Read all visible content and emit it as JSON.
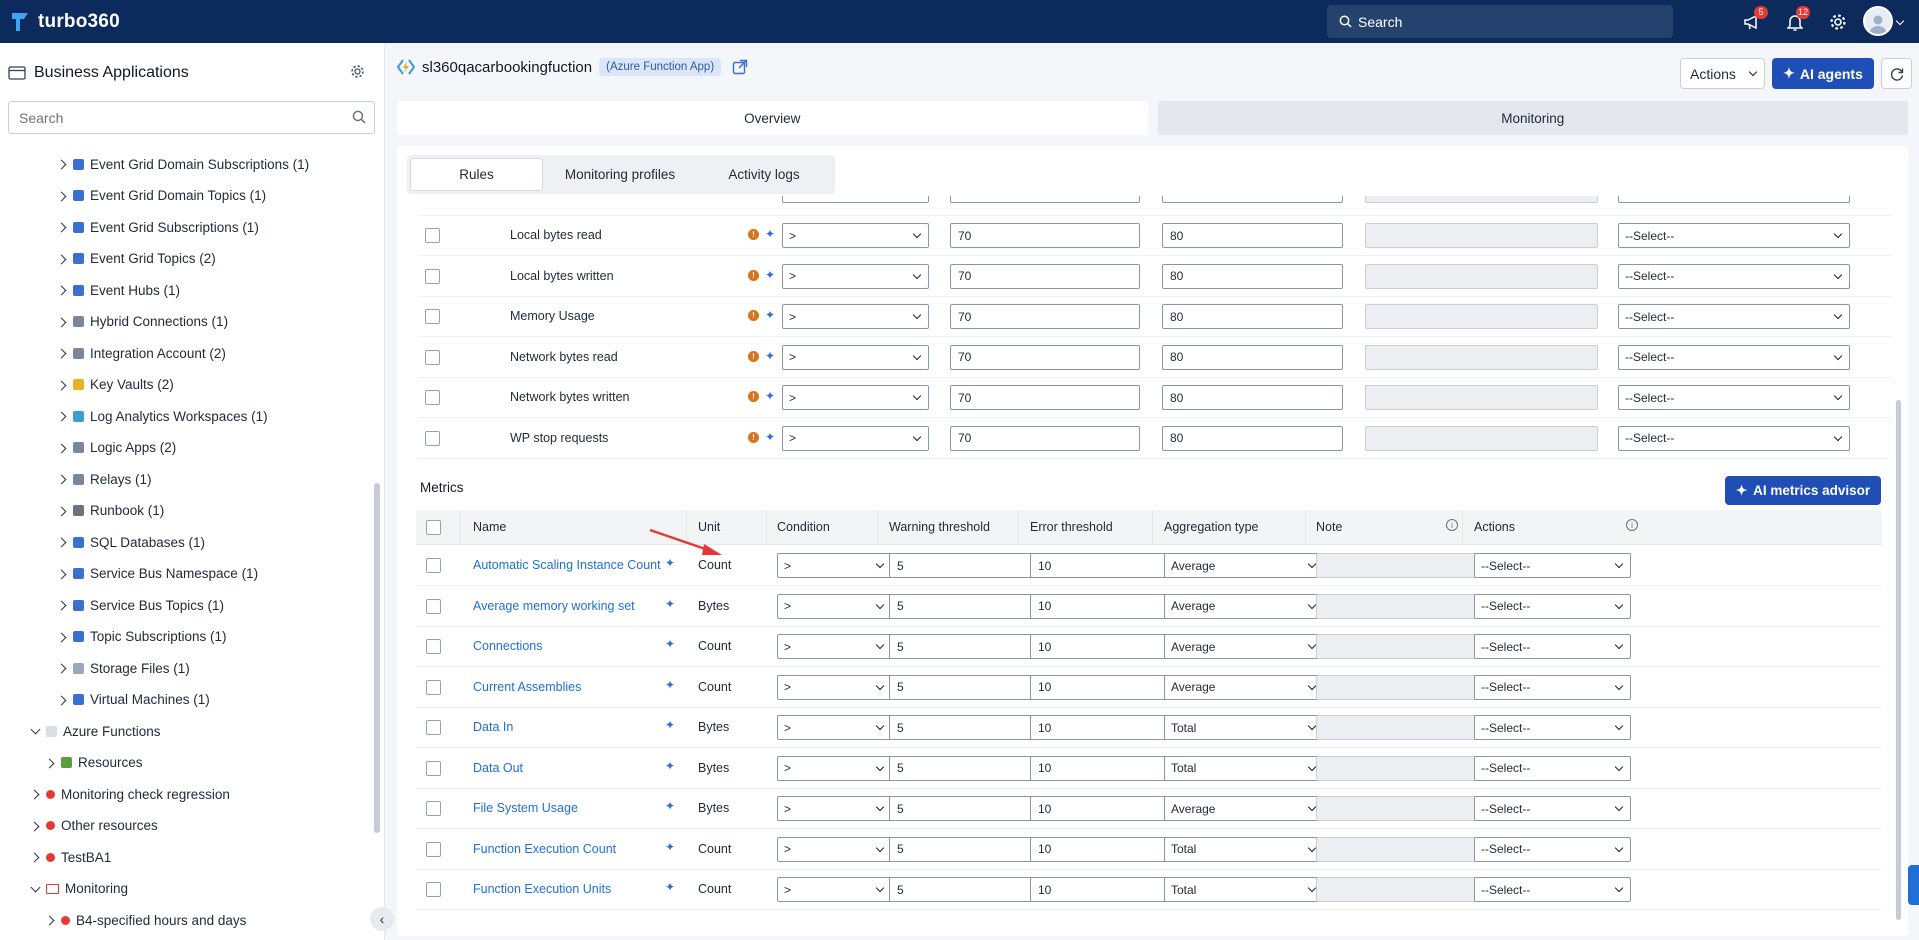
{
  "app": {
    "name": "turbo360",
    "search_placeholder": "Search",
    "notif_badge_1": "5",
    "notif_badge_2": "12"
  },
  "sidebar": {
    "title": "Business Applications",
    "search_placeholder": "Search",
    "items": [
      {
        "label": "Event Grid Domain Subscriptions (1)",
        "level": 3,
        "expand": "r",
        "color": "#3b6fd0"
      },
      {
        "label": "Event Grid Domain Topics (1)",
        "level": 3,
        "expand": "r",
        "color": "#3b6fd0"
      },
      {
        "label": "Event Grid Subscriptions (1)",
        "level": 3,
        "expand": "r",
        "color": "#3b6fd0"
      },
      {
        "label": "Event Grid Topics (2)",
        "level": 3,
        "expand": "r",
        "color": "#3b6fd0"
      },
      {
        "label": "Event Hubs (1)",
        "level": 3,
        "expand": "r",
        "color": "#3b6fd0"
      },
      {
        "label": "Hybrid Connections (1)",
        "level": 3,
        "expand": "r",
        "color": "#7a8699"
      },
      {
        "label": "Integration Account (2)",
        "level": 3,
        "expand": "r",
        "color": "#7a8699"
      },
      {
        "label": "Key Vaults (2)",
        "level": 3,
        "expand": "r",
        "color": "#e6b422"
      },
      {
        "label": "Log Analytics Workspaces (1)",
        "level": 3,
        "expand": "r",
        "color": "#3b9fd0"
      },
      {
        "label": "Logic Apps (2)",
        "level": 3,
        "expand": "r",
        "color": "#7a8699"
      },
      {
        "label": "Relays (1)",
        "level": 3,
        "expand": "r",
        "color": "#7a8699"
      },
      {
        "label": "Runbook (1)",
        "level": 3,
        "expand": "r",
        "color": "#6b7280"
      },
      {
        "label": "SQL Databases (1)",
        "level": 3,
        "expand": "r",
        "color": "#3b6fd0"
      },
      {
        "label": "Service Bus Namespace (1)",
        "level": 3,
        "expand": "r",
        "color": "#3b6fd0"
      },
      {
        "label": "Service Bus Topics (1)",
        "level": 3,
        "expand": "r",
        "color": "#3b6fd0"
      },
      {
        "label": "Topic Subscriptions (1)",
        "level": 3,
        "expand": "r",
        "color": "#3b6fd0"
      },
      {
        "label": "Storage Files (1)",
        "level": 3,
        "expand": "r",
        "color": "#9aa7bd"
      },
      {
        "label": "Virtual Machines (1)",
        "level": 3,
        "expand": "r",
        "color": "#3b6fd0"
      },
      {
        "label": "Azure Functions",
        "level": 1,
        "expand": "d",
        "color": "#d9dde4"
      },
      {
        "label": "Resources",
        "level": 2,
        "expand": "r",
        "color": "#5aa03a"
      },
      {
        "label": "Monitoring check regression",
        "level": 0,
        "expand": "r",
        "color": "red"
      },
      {
        "label": "Other resources",
        "level": 0,
        "expand": "r",
        "color": "red"
      },
      {
        "label": "TestBA1",
        "level": 0,
        "expand": "r",
        "color": "red"
      },
      {
        "label": "Monitoring",
        "level": 0,
        "expand": "d",
        "color": "folder"
      },
      {
        "label": "B4-specified hours and days",
        "level": 2,
        "expand": "r",
        "color": "red"
      }
    ]
  },
  "header": {
    "resource_name": "sl360qacarbookingfuction",
    "resource_type": "(Azure Function App)",
    "actions_label": "Actions",
    "ai_agents_label": "AI agents"
  },
  "top_tabs": [
    "Overview",
    "Monitoring"
  ],
  "sub_tabs": [
    "Rules",
    "Monitoring profiles",
    "Activity logs"
  ],
  "rules": [
    {
      "name": "Local bytes read",
      "condition": ">",
      "warning": "70",
      "error": "80",
      "action": "--Select--"
    },
    {
      "name": "Local bytes written",
      "condition": ">",
      "warning": "70",
      "error": "80",
      "action": "--Select--"
    },
    {
      "name": "Memory Usage",
      "condition": ">",
      "warning": "70",
      "error": "80",
      "action": "--Select--"
    },
    {
      "name": "Network bytes read",
      "condition": ">",
      "warning": "70",
      "error": "80",
      "action": "--Select--"
    },
    {
      "name": "Network bytes written",
      "condition": ">",
      "warning": "70",
      "error": "80",
      "action": "--Select--"
    },
    {
      "name": "WP stop requests",
      "condition": ">",
      "warning": "70",
      "error": "80",
      "action": "--Select--"
    }
  ],
  "metrics": {
    "section_label": "Metrics",
    "advisor_label": "AI metrics advisor",
    "columns": [
      "Name",
      "Unit",
      "Condition",
      "Warning threshold",
      "Error threshold",
      "Aggregation type",
      "Note",
      "Actions"
    ],
    "rows": [
      {
        "name": "Automatic Scaling Instance Count",
        "unit": "Count",
        "condition": ">",
        "warning": "5",
        "error": "10",
        "aggregation": "Average",
        "action": "--Select--"
      },
      {
        "name": "Average memory working set",
        "unit": "Bytes",
        "condition": ">",
        "warning": "5",
        "error": "10",
        "aggregation": "Average",
        "action": "--Select--"
      },
      {
        "name": "Connections",
        "unit": "Count",
        "condition": ">",
        "warning": "5",
        "error": "10",
        "aggregation": "Average",
        "action": "--Select--"
      },
      {
        "name": "Current Assemblies",
        "unit": "Count",
        "condition": ">",
        "warning": "5",
        "error": "10",
        "aggregation": "Average",
        "action": "--Select--"
      },
      {
        "name": "Data In",
        "unit": "Bytes",
        "condition": ">",
        "warning": "5",
        "error": "10",
        "aggregation": "Total",
        "action": "--Select--"
      },
      {
        "name": "Data Out",
        "unit": "Bytes",
        "condition": ">",
        "warning": "5",
        "error": "10",
        "aggregation": "Total",
        "action": "--Select--"
      },
      {
        "name": "File System Usage",
        "unit": "Bytes",
        "condition": ">",
        "warning": "5",
        "error": "10",
        "aggregation": "Average",
        "action": "--Select--"
      },
      {
        "name": "Function Execution Count",
        "unit": "Count",
        "condition": ">",
        "warning": "5",
        "error": "10",
        "aggregation": "Total",
        "action": "--Select--"
      },
      {
        "name": "Function Execution Units",
        "unit": "Count",
        "condition": ">",
        "warning": "5",
        "error": "10",
        "aggregation": "Total",
        "action": "--Select--"
      }
    ]
  },
  "colors": {
    "brand": "#0c2a5c",
    "primary": "#1f4fb6",
    "link": "#1f6fd6",
    "warn": "#d9741a",
    "annotation_arrow": "#e53935"
  }
}
